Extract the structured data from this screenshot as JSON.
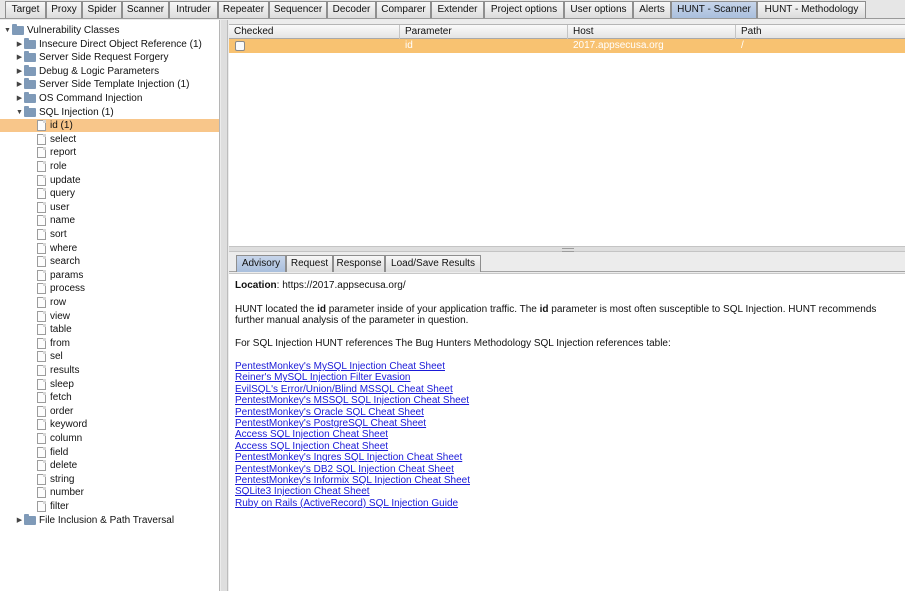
{
  "top_tabs": [
    "Target",
    "Proxy",
    "Spider",
    "Scanner",
    "Intruder",
    "Repeater",
    "Sequencer",
    "Decoder",
    "Comparer",
    "Extender",
    "Project options",
    "User options",
    "Alerts",
    "HUNT - Scanner",
    "HUNT - Methodology"
  ],
  "tree": {
    "root": "Vulnerability Classes",
    "categories": [
      "Insecure Direct Object Reference (1)",
      "Server Side Request Forgery",
      "Debug & Logic Parameters",
      "Server Side Template Injection (1)",
      "OS Command Injection"
    ],
    "expanded_category": "SQL Injection (1)",
    "params": [
      "id (1)",
      "select",
      "report",
      "role",
      "update",
      "query",
      "user",
      "name",
      "sort",
      "where",
      "search",
      "params",
      "process",
      "row",
      "view",
      "table",
      "from",
      "sel",
      "results",
      "sleep",
      "fetch",
      "order",
      "keyword",
      "column",
      "field",
      "delete",
      "string",
      "number",
      "filter"
    ],
    "last_category": "File Inclusion & Path Traversal"
  },
  "table": {
    "headers": [
      "Checked",
      "Parameter",
      "Host",
      "Path"
    ],
    "rows": [
      {
        "checked": false,
        "parameter": "id",
        "host": "2017.appsecusa.org",
        "path": "/"
      }
    ]
  },
  "sub_tabs": [
    "Advisory",
    "Request",
    "Response",
    "Load/Save Results"
  ],
  "advisory": {
    "location_label": "Location",
    "location_value": ": https://2017.appsecusa.org/",
    "desc_prefix": "HUNT located the ",
    "param": "id",
    "desc_mid": " parameter inside of your application traffic. The ",
    "desc_suffix": " parameter is most often susceptible to SQL Injection. HUNT recommends",
    "desc_line2": "further manual analysis of the parameter in question.",
    "references_intro": "For SQL Injection HUNT references The Bug Hunters Methodology SQL Injection references table:",
    "links": [
      "PentestMonkey's MySQL Injection Cheat Sheet",
      "Reiner's MySQL Injection Filter Evasion",
      "EvilSQL's Error/Union/Blind MSSQL Cheat Sheet",
      "PentestMonkey's MSSQL SQL Injection Cheat Sheet",
      "PentestMonkey's Oracle SQL Cheat Sheet",
      "PentestMonkey's PostgreSQL Cheat Sheet",
      "Access SQL Injection Cheat Sheet",
      "Access SQL Injection Cheat Sheet",
      "PentestMonkey's Ingres SQL Injection Cheat Sheet",
      "PentestMonkey's DB2 SQL Injection Cheat Sheet",
      "PentestMonkey's Informix SQL Injection Cheat Sheet",
      "SQLite3 Injection Cheat Sheet",
      "Ruby on Rails (ActiveRecord) SQL Injection Guide"
    ]
  },
  "colors": {
    "selection": "#f8c68a",
    "row_highlight": "#f8c271",
    "active_tab": "#b7c9e3",
    "link": "#1a1ad8"
  }
}
